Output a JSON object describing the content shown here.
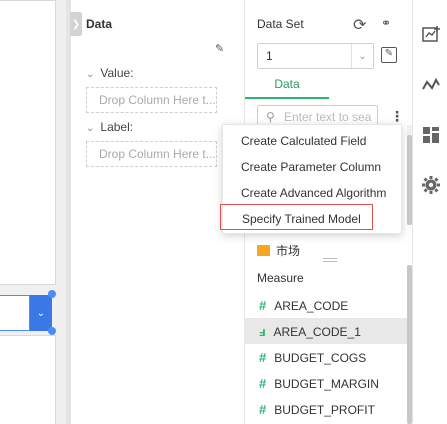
{
  "data_panel": {
    "title": "Data",
    "value_label": "Value:",
    "label_label": "Label:",
    "drop_placeholder_value": "Drop Column Here t...",
    "drop_placeholder_label": "Drop Column Here t..."
  },
  "dataset_panel": {
    "title": "Data Set",
    "selected_dataset": "1",
    "tab_data": "Data",
    "search_placeholder": "Enter text to sea",
    "folder_name": "市场",
    "measure_header": "Measure",
    "fields": [
      {
        "name": "AREA_CODE",
        "icon": "number-icon"
      },
      {
        "name": "AREA_CODE_1",
        "icon": "number-alt-icon"
      },
      {
        "name": "BUDGET_COGS",
        "icon": "number-icon"
      },
      {
        "name": "BUDGET_MARGIN",
        "icon": "number-icon"
      },
      {
        "name": "BUDGET_PROFIT",
        "icon": "number-icon"
      }
    ]
  },
  "context_menu": {
    "items": [
      "Create Calculated Field",
      "Create Parameter Column",
      "Create Advanced Algorithm",
      "Specify Trained Model"
    ]
  },
  "right_toolbar": {
    "icons": [
      "chart-add-icon",
      "line-chart-icon",
      "dashboard-icon",
      "gear-icon"
    ]
  },
  "colors": {
    "accent_green": "#2bb673",
    "accent_blue": "#3b78e7",
    "highlight_red": "#d9534f",
    "folder_orange": "#f5a623"
  }
}
